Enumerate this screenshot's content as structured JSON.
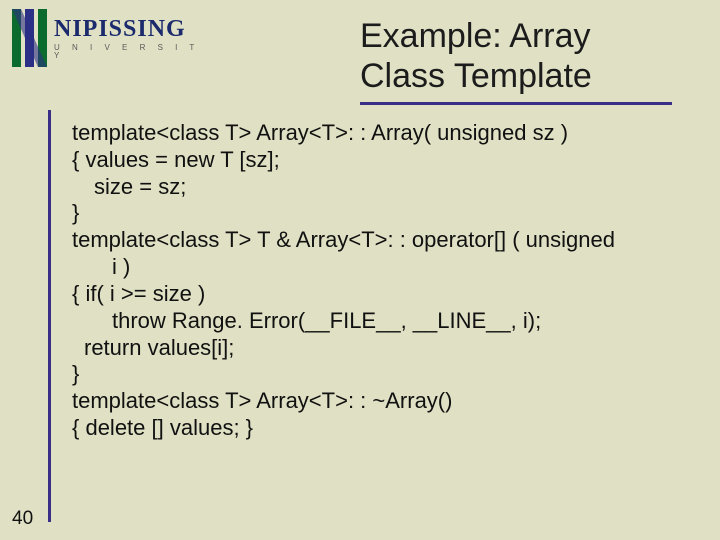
{
  "logo": {
    "name": "NIPISSING",
    "sub": "U N I V E R S I T Y"
  },
  "title": {
    "line1": "Example: Array",
    "line2": "Class Template"
  },
  "body": {
    "l1": "template<class T> Array<T>: : Array( unsigned sz )",
    "l2": "{  values = new T [sz];",
    "l3": "size = sz;",
    "l4": "}",
    "l5": "template<class T> T & Array<T>: : operator[] ( unsigned",
    "l6": "i )",
    "l7": "{  if( i >= size )",
    "l8": "throw Range. Error(__FILE__, __LINE__, i);",
    "l9": "return values[i];",
    "l10": "}",
    "l11": "template<class T> Array<T>: : ~Array()",
    "l12": "{  delete [] values; }"
  },
  "page_number": "40"
}
